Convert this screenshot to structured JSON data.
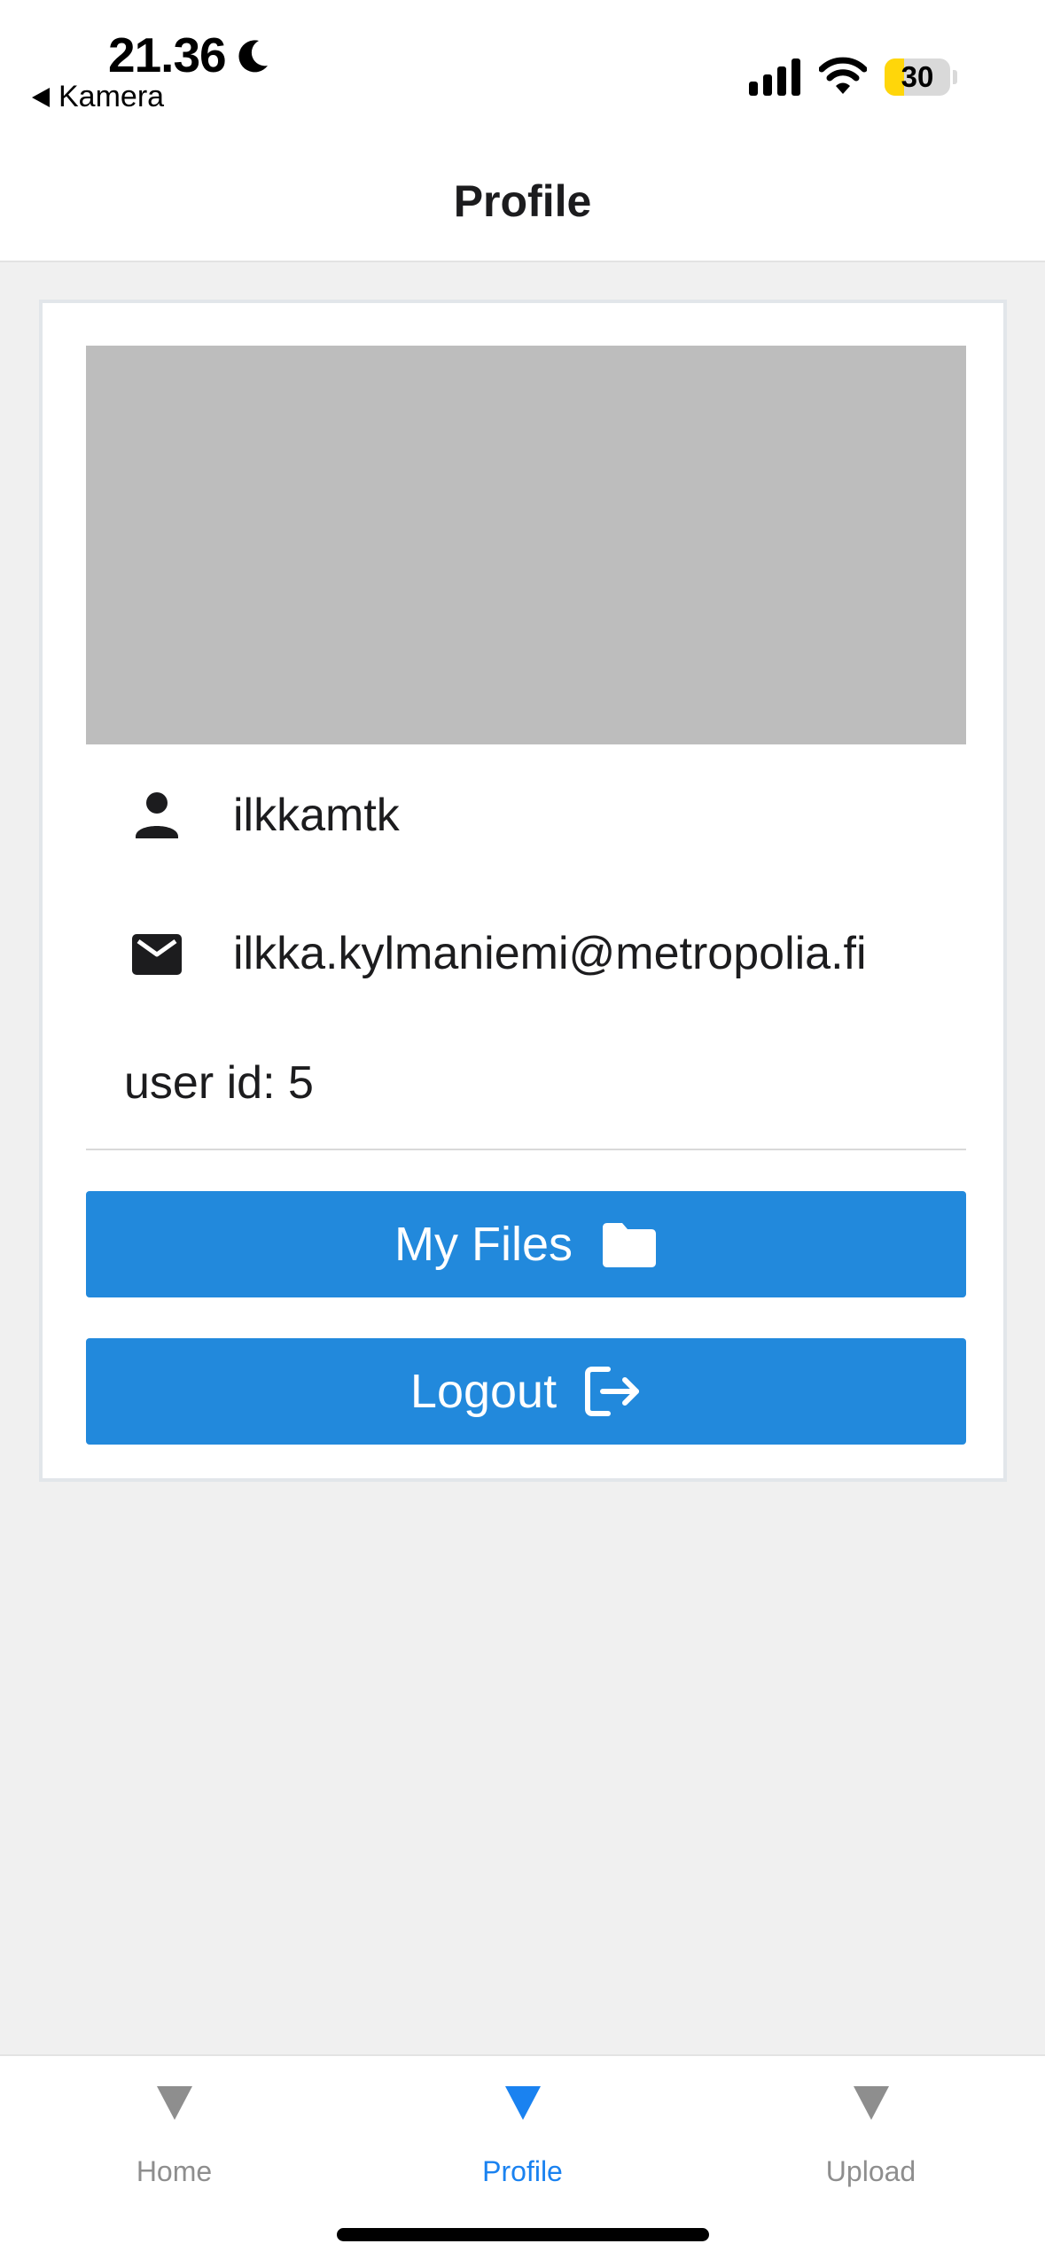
{
  "status_bar": {
    "time": "21.36",
    "back_label": "Kamera",
    "battery_level": "30",
    "battery_fraction": 0.3,
    "icons": [
      "moon-icon",
      "signal-icon",
      "wifi-icon",
      "battery-icon"
    ]
  },
  "header": {
    "title": "Profile"
  },
  "profile": {
    "username": "ilkkamtk",
    "email": "ilkka.kylmaniemi@metropolia.fi",
    "user_id_text": "user id: 5"
  },
  "buttons": {
    "my_files": "My Files",
    "logout": "Logout"
  },
  "tabs": [
    {
      "label": "Home",
      "active": false
    },
    {
      "label": "Profile",
      "active": true
    },
    {
      "label": "Upload",
      "active": false
    }
  ],
  "colors": {
    "primary_button": "#2289dc",
    "active_tab": "#1a82f0",
    "inactive_tab": "#8e8e8e",
    "avatar_placeholder": "#bdbdbd",
    "battery_fill": "#ffd60a"
  }
}
